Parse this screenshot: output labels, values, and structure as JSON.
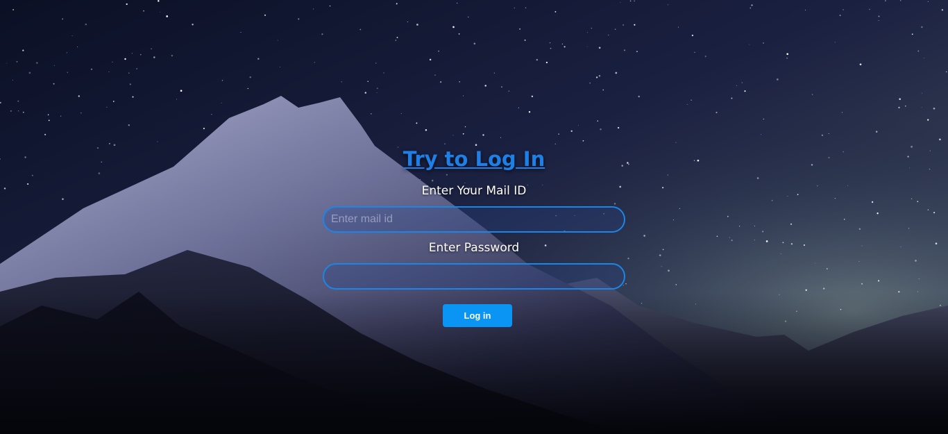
{
  "page": {
    "title": "Try to Log In"
  },
  "form": {
    "mail_label": "Enter Your Mail ID",
    "mail_placeholder": "Enter mail id",
    "mail_value": "",
    "password_label": "Enter Password",
    "password_value": "",
    "submit_label": "Log in"
  },
  "colors": {
    "accent": "#1e7fe6",
    "button": "#0a95f5",
    "sky_top": "#0b1025",
    "sky_glow": "#4a5a6e",
    "snow": "#c3c6e0"
  },
  "background": {
    "scene": "starry-night-mountain"
  }
}
